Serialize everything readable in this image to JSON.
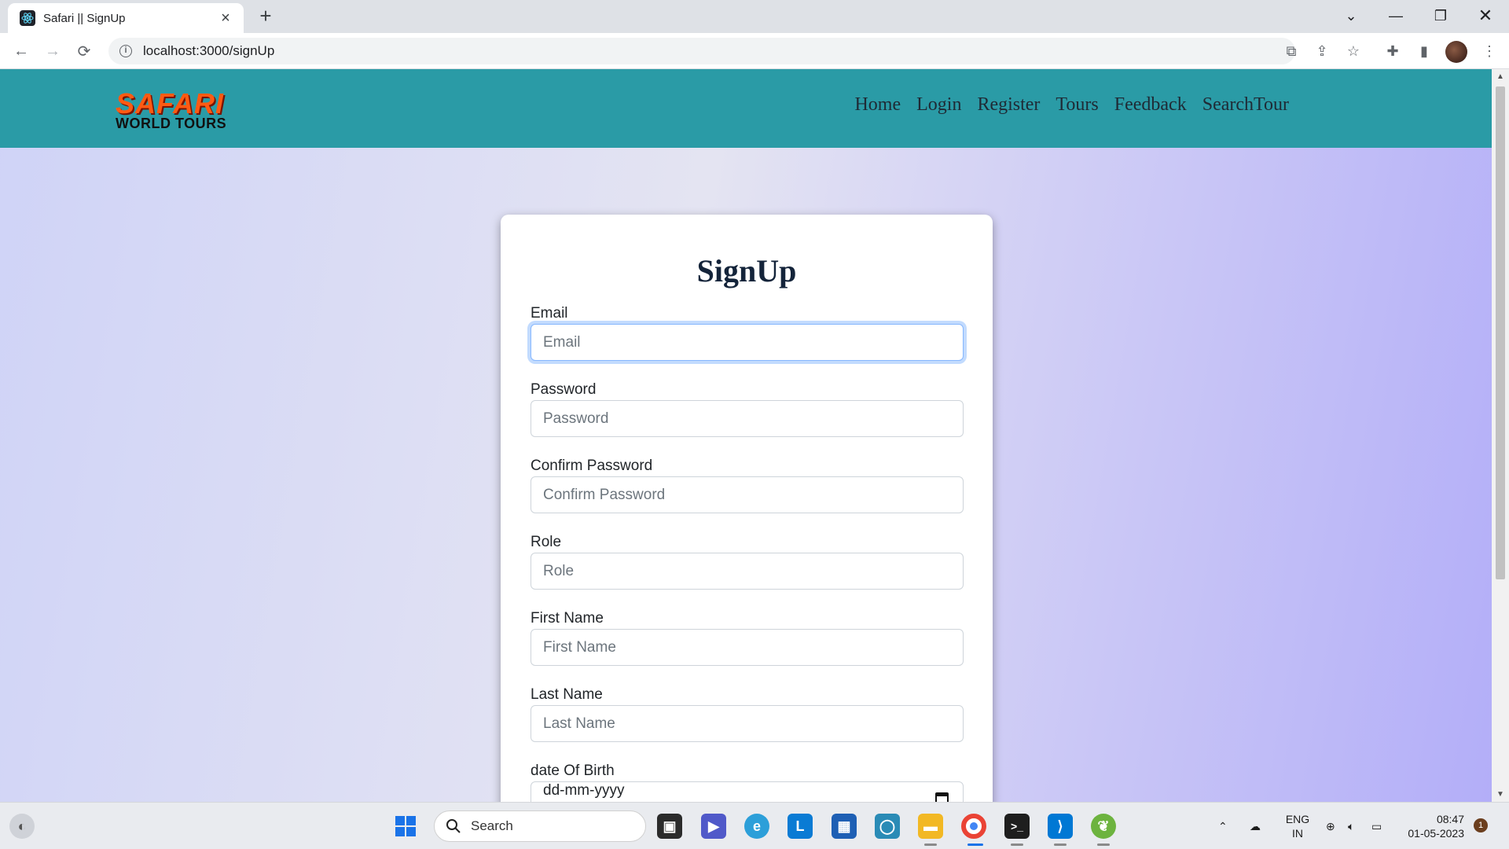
{
  "browser": {
    "tab_title": "Safari || SignUp",
    "url": "localhost:3000/signUp"
  },
  "site": {
    "logo": {
      "line1": "SAFARI",
      "line2": "WORLD TOURS"
    },
    "nav": [
      "Home",
      "Login",
      "Register",
      "Tours",
      "Feedback",
      "SearchTour"
    ]
  },
  "form": {
    "title": "SignUp",
    "fields": [
      {
        "label": "Email",
        "placeholder": "Email",
        "focused": true
      },
      {
        "label": "Password",
        "placeholder": "Password"
      },
      {
        "label": "Confirm Password",
        "placeholder": "Confirm Password"
      },
      {
        "label": "Role",
        "placeholder": "Role"
      },
      {
        "label": "First Name",
        "placeholder": "First Name"
      },
      {
        "label": "Last Name",
        "placeholder": "Last Name"
      },
      {
        "label": "date Of Birth",
        "placeholder": "dd-mm-yyyy"
      }
    ]
  },
  "taskbar": {
    "search_label": "Search",
    "language": {
      "line1": "ENG",
      "line2": "IN"
    },
    "time": "08:47",
    "date": "01-05-2023",
    "notification_count": "1"
  },
  "colors": {
    "header_bg": "#2a9ba6",
    "logo_orange": "#ff5a12",
    "focus_ring": "#86b7fe"
  }
}
